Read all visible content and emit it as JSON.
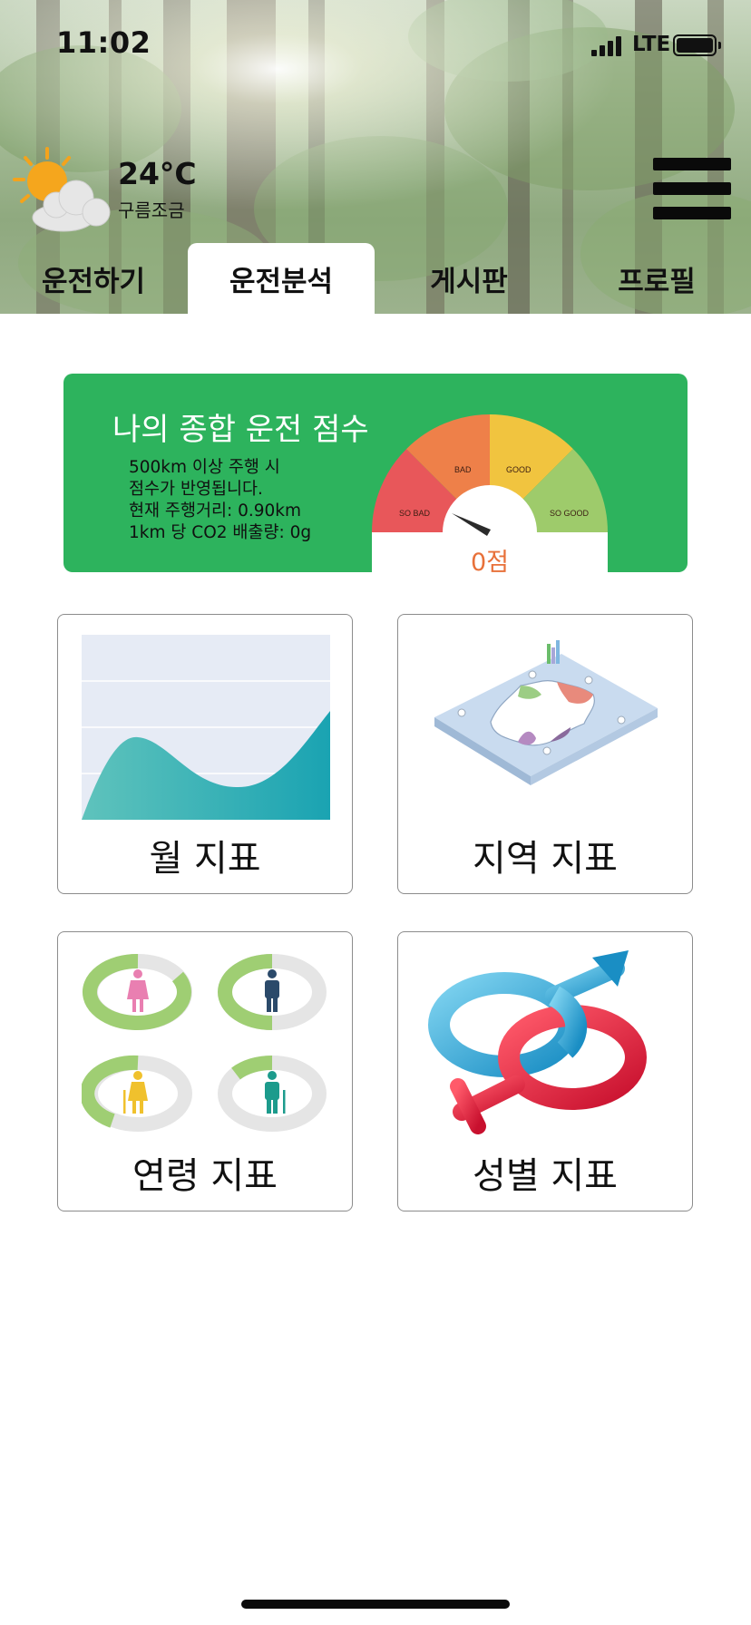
{
  "status_bar": {
    "time": "11:02",
    "network": "LTE"
  },
  "weather": {
    "temperature": "24°C",
    "condition": "구름조금",
    "icon": "partly-cloudy-icon"
  },
  "header": {
    "menu_icon": "hamburger-menu-icon"
  },
  "tabs": [
    {
      "label": "운전하기",
      "active": false
    },
    {
      "label": "운전분석",
      "active": true
    },
    {
      "label": "게시판",
      "active": false
    },
    {
      "label": "프로필",
      "active": false
    }
  ],
  "score_card": {
    "title": "나의 종합 운전 점수",
    "lines": [
      "500km 이상 주행 시",
      "점수가 반영됩니다.",
      "현재 주행거리: 0.90km",
      "1km 당 CO2 배출량: 0g"
    ],
    "gauge_labels": [
      "SO BAD",
      "BAD",
      "GOOD",
      "SO GOOD"
    ],
    "score": "0점",
    "colors": {
      "card": "#2db35d",
      "so_bad": "#e8575a",
      "bad": "#ee8049",
      "good": "#f1c43f",
      "so_good": "#9ecb6b",
      "score_text": "#e8713a"
    }
  },
  "tiles": [
    {
      "label": "월 지표",
      "icon": "area-chart-icon"
    },
    {
      "label": "지역 지표",
      "icon": "isometric-map-icon"
    },
    {
      "label": "연령 지표",
      "icon": "age-donut-icons"
    },
    {
      "label": "성별 지표",
      "icon": "gender-symbols-icon"
    }
  ]
}
